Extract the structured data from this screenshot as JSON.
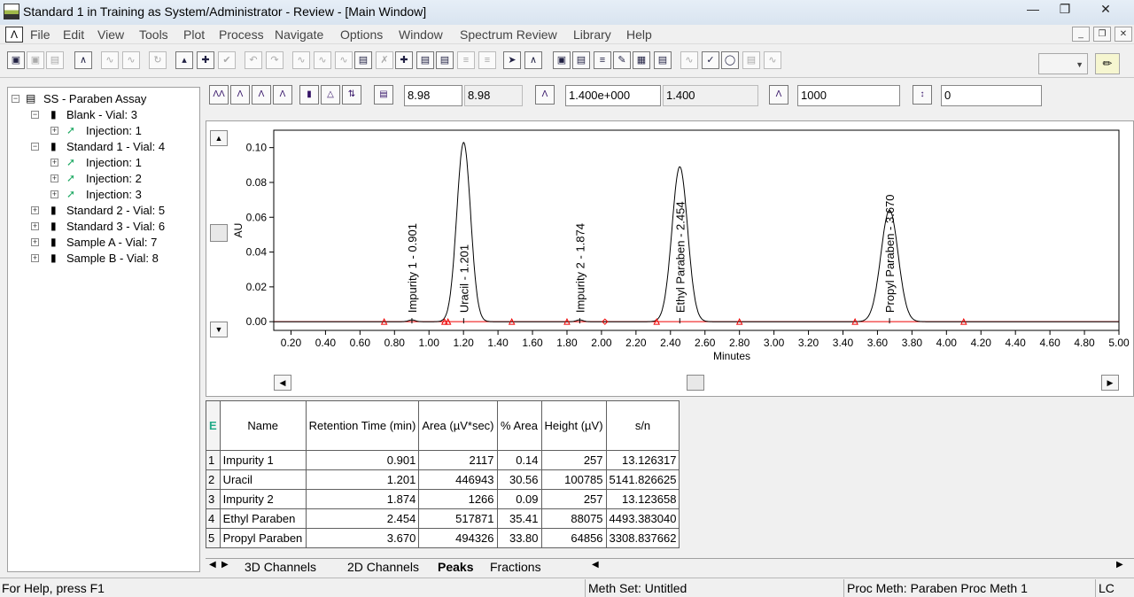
{
  "window": {
    "title": "Standard 1 in Training as System/Administrator - Review - [Main Window]"
  },
  "menu": [
    "File",
    "Edit",
    "View",
    "Tools",
    "Plot",
    "Process",
    "Navigate",
    "Options",
    "Window",
    "Spectrum Review",
    "Library",
    "Help"
  ],
  "tree": {
    "root": "SS - Paraben Assay",
    "items": [
      {
        "label": "Blank - Vial: 3",
        "level": 1
      },
      {
        "label": "Injection: 1",
        "level": 2
      },
      {
        "label": "Standard 1 - Vial: 4",
        "level": 1
      },
      {
        "label": "Injection: 1",
        "level": 2
      },
      {
        "label": "Injection: 2",
        "level": 2
      },
      {
        "label": "Injection: 3",
        "level": 2
      },
      {
        "label": "Standard 2 - Vial: 5",
        "level": 1
      },
      {
        "label": "Standard 3 - Vial: 6",
        "level": 1
      },
      {
        "label": "Sample A - Vial: 7",
        "level": 1
      },
      {
        "label": "Sample B - Vial: 8",
        "level": 1
      }
    ]
  },
  "chart_tools": {
    "x_min_value": "8.98",
    "x_min_readonly": "8.98",
    "y_scale_value": "1.400e+000",
    "y_scale_readonly": "1.400",
    "threshold_value": "1000",
    "offset_value": "0"
  },
  "chart_data": {
    "type": "line",
    "xlabel": "Minutes",
    "ylabel": "AU",
    "xlim": [
      0.1,
      5.0
    ],
    "ylim": [
      -0.005,
      0.11
    ],
    "x_ticks": [
      "0.20",
      "0.40",
      "0.60",
      "0.80",
      "1.00",
      "1.20",
      "1.40",
      "1.60",
      "1.80",
      "2.00",
      "2.20",
      "2.40",
      "2.60",
      "2.80",
      "3.00",
      "3.20",
      "3.40",
      "3.60",
      "3.80",
      "4.00",
      "4.20",
      "4.40",
      "4.60",
      "4.80",
      "5.00"
    ],
    "y_ticks": [
      "0.00",
      "0.02",
      "0.04",
      "0.06",
      "0.08",
      "0.10"
    ],
    "peaks": [
      {
        "label": "Impurity 1 - 0.901",
        "rt": 0.901,
        "height": 0.001
      },
      {
        "label": "Uracil - 1.201",
        "rt": 1.201,
        "height": 0.103
      },
      {
        "label": "Impurity 2 - 1.874",
        "rt": 1.874,
        "height": 0.001
      },
      {
        "label": "Ethyl Paraben - 2.454",
        "rt": 2.454,
        "height": 0.089
      },
      {
        "label": "Propyl Paraben - 3.670",
        "rt": 3.67,
        "height": 0.064
      }
    ],
    "grid": false
  },
  "peaks_table": {
    "headers": [
      "Name",
      "Retention Time (min)",
      "Area (µV*sec)",
      "% Area",
      "Height (µV)",
      "s/n"
    ],
    "rows": [
      {
        "idx": "1",
        "name": "Impurity 1",
        "rt": "0.901",
        "area": "2117",
        "pct": "0.14",
        "height": "257",
        "sn": "13.126317"
      },
      {
        "idx": "2",
        "name": "Uracil",
        "rt": "1.201",
        "area": "446943",
        "pct": "30.56",
        "height": "100785",
        "sn": "5141.826625"
      },
      {
        "idx": "3",
        "name": "Impurity 2",
        "rt": "1.874",
        "area": "1266",
        "pct": "0.09",
        "height": "257",
        "sn": "13.123658"
      },
      {
        "idx": "4",
        "name": "Ethyl Paraben",
        "rt": "2.454",
        "area": "517871",
        "pct": "35.41",
        "height": "88075",
        "sn": "4493.383040"
      },
      {
        "idx": "5",
        "name": "Propyl Paraben",
        "rt": "3.670",
        "area": "494326",
        "pct": "33.80",
        "height": "64856",
        "sn": "3308.837662"
      }
    ]
  },
  "tabs": [
    "3D Channels",
    "2D Channels",
    "Peaks",
    "Fractions"
  ],
  "status": {
    "help": "For Help, press F1",
    "meth_set": "Meth Set: Untitled",
    "proc_meth": "Proc Meth: Paraben Proc Meth 1",
    "mode": "LC"
  }
}
